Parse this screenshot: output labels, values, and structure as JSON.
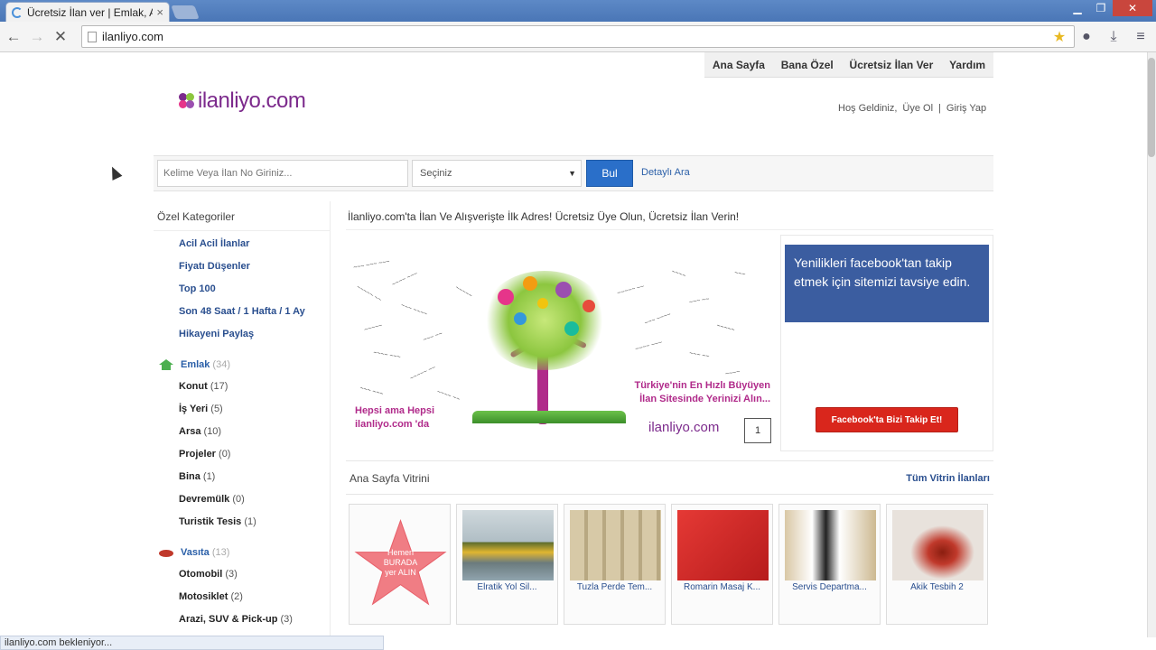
{
  "browser": {
    "tab_title": "Ücretsiz İlan ver | Emlak, A",
    "tab_close": "×",
    "url": "ilanliyo.com",
    "status": "ilanliyo.com bekleniyor..."
  },
  "topnav": [
    "Ana Sayfa",
    "Bana Özel",
    "Ücretsiz İlan Ver",
    "Yardım"
  ],
  "logo": "ilanliyo.com",
  "welcome": {
    "greeting": "Hoş Geldiniz,",
    "register": "Üye Ol",
    "separator": "|",
    "login": "Giriş Yap"
  },
  "search": {
    "placeholder": "Kelime Veya İlan No Giriniz...",
    "select_value": "Seçiniz",
    "button": "Bul",
    "advanced": "Detaylı Ara"
  },
  "sidebar": {
    "heading": "Özel Kategoriler",
    "special_links": [
      "Acil Acil İlanlar",
      "Fiyatı Düşenler",
      "Top 100",
      "Son 48 Saat / 1 Hafta / 1 Ay",
      "Hikayeni Paylaş"
    ],
    "categories": [
      {
        "name": "Emlak",
        "count": "(34)",
        "items": [
          {
            "name": "Konut",
            "count": "(17)"
          },
          {
            "name": "İş Yeri",
            "count": "(5)"
          },
          {
            "name": "Arsa",
            "count": "(10)"
          },
          {
            "name": "Projeler",
            "count": "(0)"
          },
          {
            "name": "Bina",
            "count": "(1)"
          },
          {
            "name": "Devremülk",
            "count": "(0)"
          },
          {
            "name": "Turistik Tesis",
            "count": "(1)"
          }
        ]
      },
      {
        "name": "Vasıta",
        "count": "(13)",
        "items": [
          {
            "name": "Otomobil",
            "count": "(3)"
          },
          {
            "name": "Motosiklet",
            "count": "(2)"
          },
          {
            "name": "Arazi, SUV & Pick-up",
            "count": "(3)"
          }
        ]
      }
    ]
  },
  "headline": "İlanliyo.com'ta İlan Ve Alışverişte İlk Adres! Ücretsiz Üye Olun, Ücretsiz İlan Verin!",
  "banner": {
    "slogan_left": [
      "Hepsi ama Hepsi",
      "ilanliyo.com 'da"
    ],
    "slogan_right": [
      "Türkiye'nin En Hızlı Büyüyen",
      "İlan Sitesinde Yerinizi Alın..."
    ],
    "logo": "ilanliyo.com",
    "pager": "1"
  },
  "facebook": {
    "text": "Yenilikleri facebook'tan takip etmek için sitemizi tavsiye edin.",
    "button": "Facebook'ta Bizi Takip Et!"
  },
  "vitrin": {
    "title": "Ana Sayfa Vitrini",
    "all_link": "Tüm Vitrin İlanları"
  },
  "cards": [
    {
      "caption": "",
      "star_text": [
        "Hemen",
        "BURADA",
        "yer ALIN"
      ]
    },
    {
      "caption": "Elratik Yol Sil..."
    },
    {
      "caption": "Tuzla Perde Tem..."
    },
    {
      "caption": "Romarin Masaj K..."
    },
    {
      "caption": "Servis Departma..."
    },
    {
      "caption": "Akik Tesbih 2"
    }
  ],
  "colors": {
    "brand_purple": "#7c2a8c",
    "link_blue": "#2a4f8f",
    "search_blue": "#2a6fc9",
    "facebook_blue": "#3b5da0",
    "facebook_red": "#d9261c"
  }
}
